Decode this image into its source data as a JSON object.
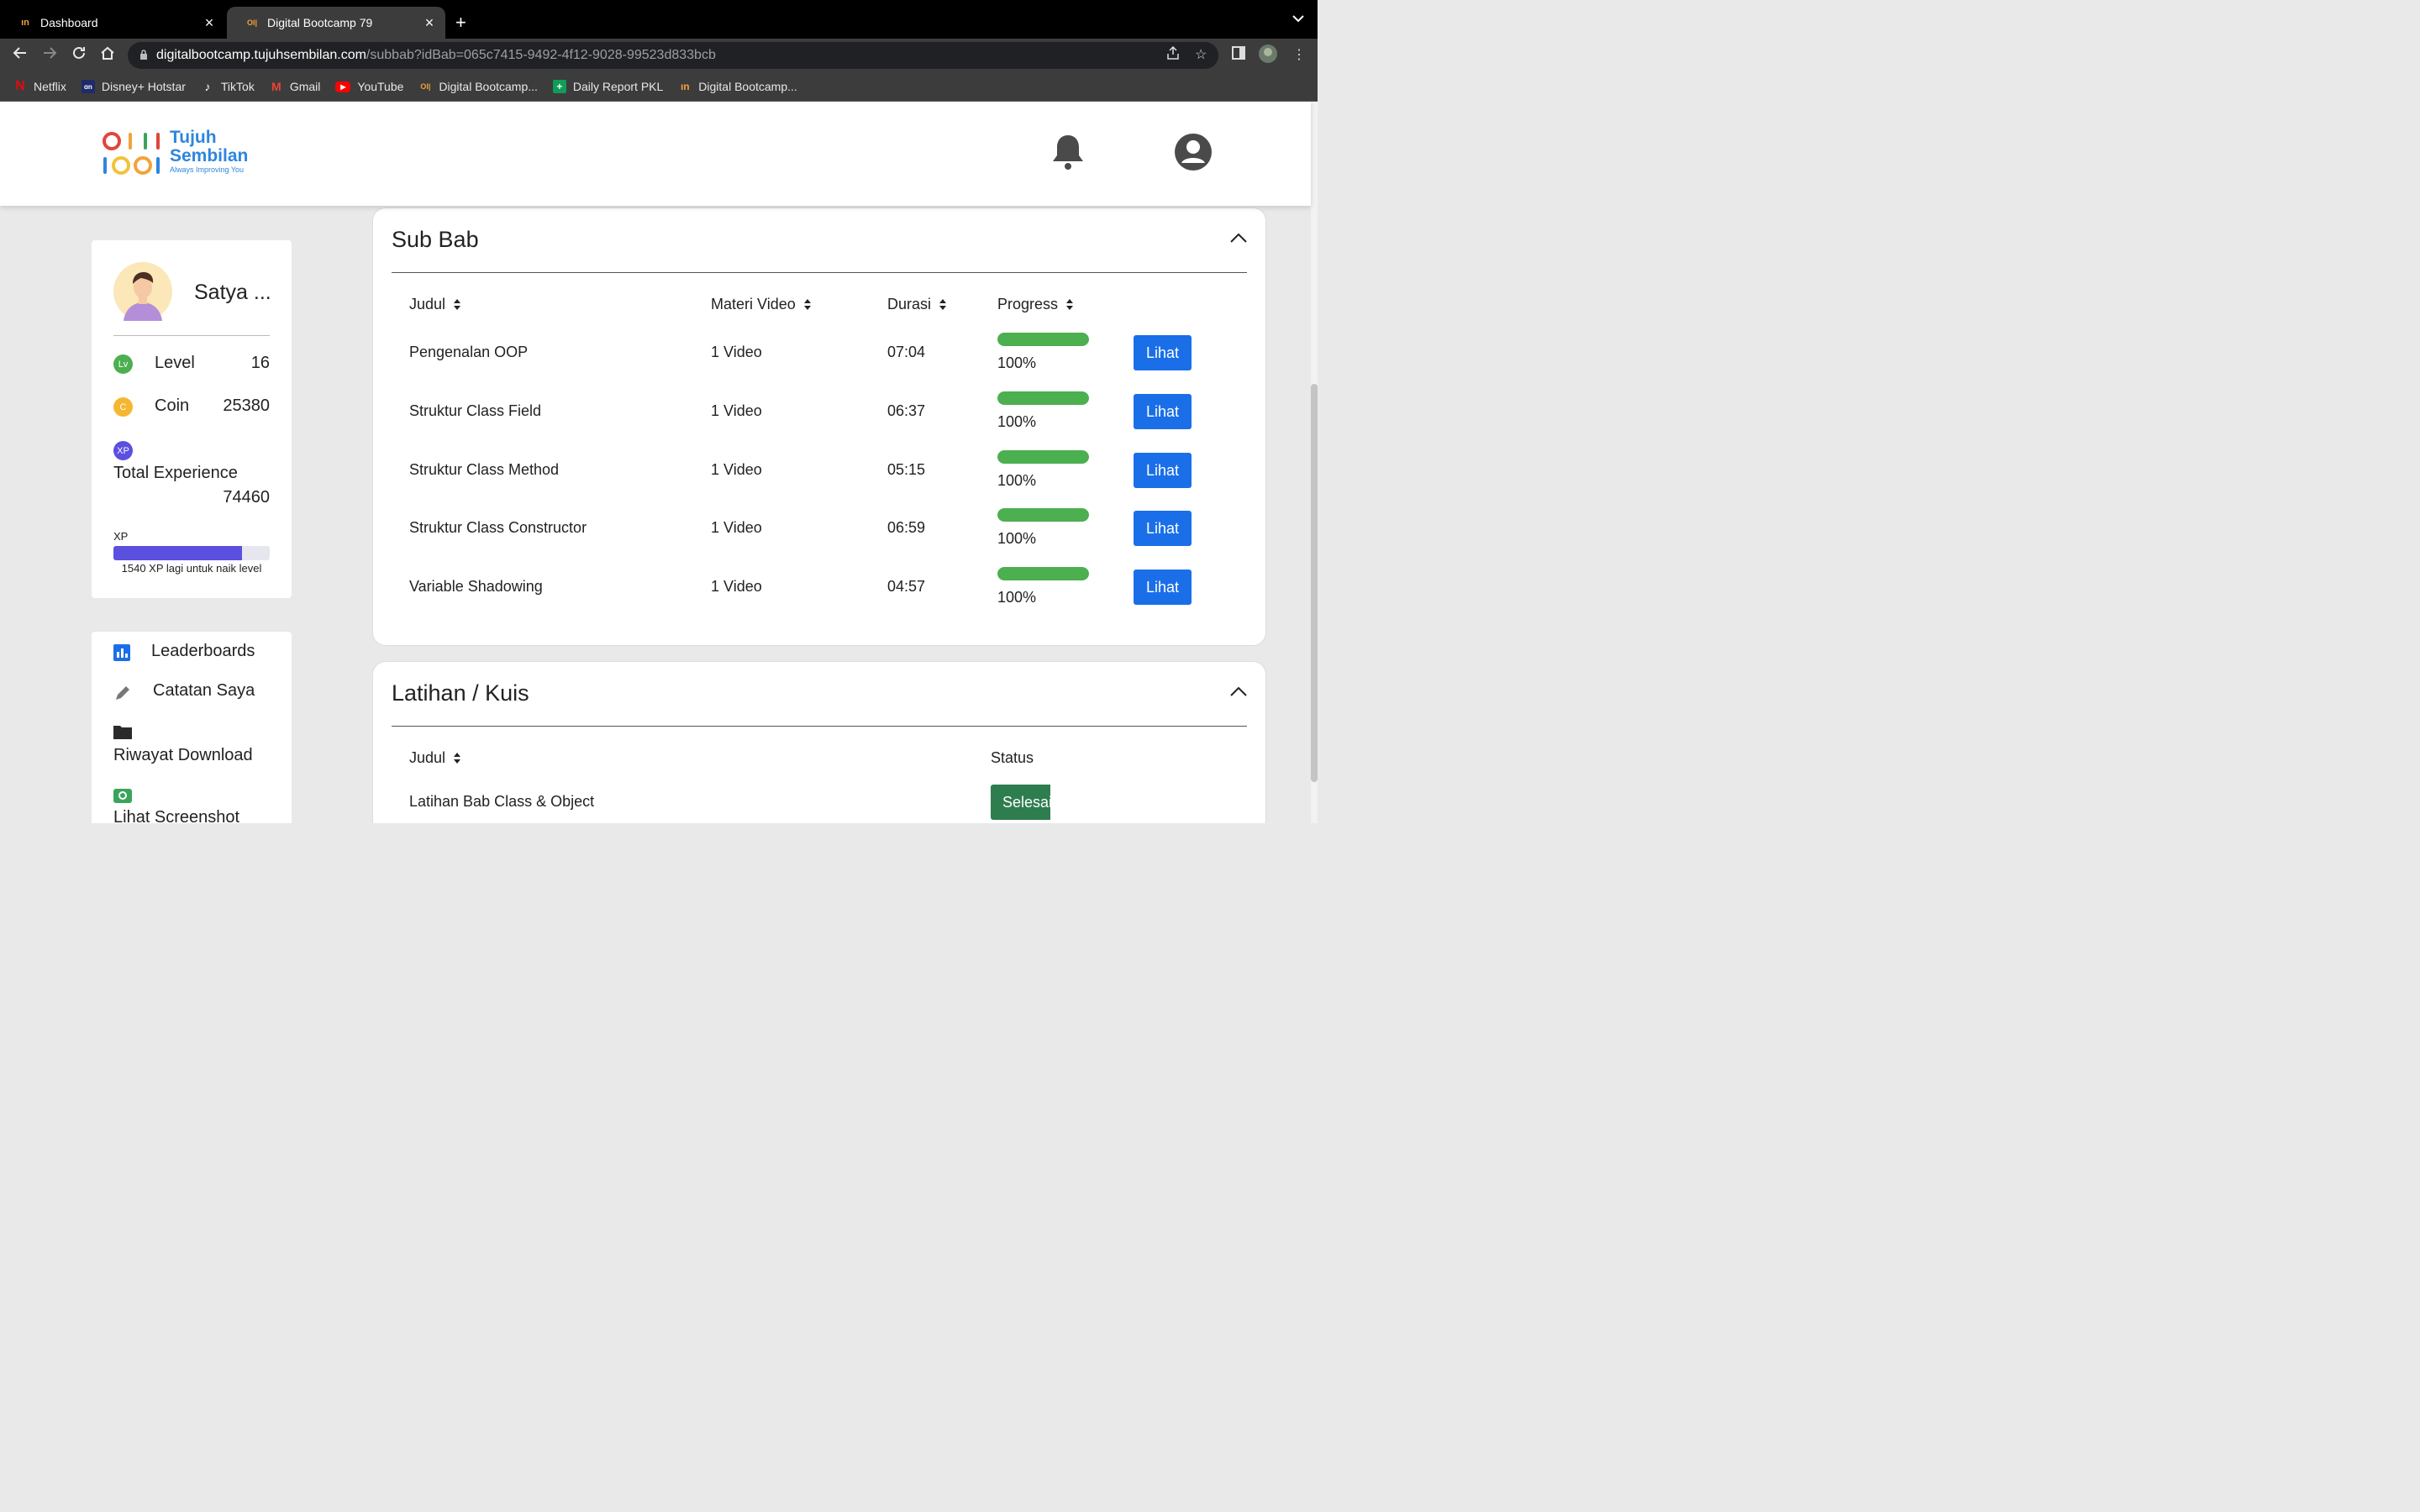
{
  "browser": {
    "tabs": [
      {
        "title": "Dashboard",
        "active": false
      },
      {
        "title": "Digital Bootcamp 79",
        "active": true
      }
    ],
    "url_host": "digitalbootcamp.tujuhsembilan.com",
    "url_path": "/subbab?idBab=065c7415-9492-4f12-9028-99523d833bcb",
    "bookmarks": [
      {
        "label": "Netflix",
        "icon": "netflix-icon",
        "color": "#e50914"
      },
      {
        "label": "Disney+ Hotstar",
        "icon": "hotstar-icon",
        "color": "#1f2a6b"
      },
      {
        "label": "TikTok",
        "icon": "tiktok-icon",
        "color": "#000000"
      },
      {
        "label": "Gmail",
        "icon": "gmail-icon",
        "color": "#ea4335"
      },
      {
        "label": "YouTube",
        "icon": "youtube-icon",
        "color": "#ff0000"
      },
      {
        "label": "Digital Bootcamp...",
        "icon": "bootcamp-icon",
        "color": "#f2a33a"
      },
      {
        "label": "Daily Report PKL",
        "icon": "sheets-icon",
        "color": "#0f9d58"
      },
      {
        "label": "Digital Bootcamp...",
        "icon": "bootcamp-icon",
        "color": "#f2a33a"
      }
    ]
  },
  "header": {
    "logo_line1": "Tujuh",
    "logo_line2": "Sembilan",
    "logo_tagline": "Always Improving You"
  },
  "profile": {
    "name": "Satya ...",
    "level_label": "Level",
    "level_badge": "Lv",
    "level_value": "16",
    "coin_label": "Coin",
    "coin_badge": "C",
    "coin_value": "25380",
    "xp_badge": "XP",
    "total_exp_label": "Total Experience",
    "total_exp_value": "74460",
    "xp_label": "XP",
    "xp_progress": 0.82,
    "xp_remaining_text": "1540 XP lagi untuk naik level"
  },
  "menu": {
    "items": [
      {
        "label": "Leaderboards",
        "icon": "bar-chart-icon"
      },
      {
        "label": "Catatan Saya",
        "icon": "pencil-icon"
      },
      {
        "label": "Riwayat Download",
        "icon": "folder-icon"
      },
      {
        "label": "Lihat Screenshot",
        "icon": "camera-icon"
      }
    ]
  },
  "subbab": {
    "title": "Sub Bab",
    "columns": [
      "Judul",
      "Materi Video",
      "Durasi",
      "Progress"
    ],
    "button_label": "Lihat",
    "rows": [
      {
        "judul": "Pengenalan OOP",
        "materi": "1 Video",
        "durasi": "07:04",
        "progress": 100,
        "progress_text": "100%"
      },
      {
        "judul": "Struktur Class Field",
        "materi": "1 Video",
        "durasi": "06:37",
        "progress": 100,
        "progress_text": "100%"
      },
      {
        "judul": "Struktur Class Method",
        "materi": "1 Video",
        "durasi": "05:15",
        "progress": 100,
        "progress_text": "100%"
      },
      {
        "judul": "Struktur Class Constructor",
        "materi": "1 Video",
        "durasi": "06:59",
        "progress": 100,
        "progress_text": "100%"
      },
      {
        "judul": "Variable Shadowing",
        "materi": "1 Video",
        "durasi": "04:57",
        "progress": 100,
        "progress_text": "100%"
      }
    ]
  },
  "latihan": {
    "title": "Latihan / Kuis",
    "col_judul": "Judul",
    "col_status": "Status",
    "rows": [
      {
        "judul": "Latihan Bab Class & Object",
        "status": "Selesai"
      }
    ]
  },
  "colors": {
    "accent_blue": "#1a6fe8",
    "progress_green": "#4caf50",
    "xp_purple": "#5b4fe0",
    "status_green": "#2e7d4f"
  }
}
